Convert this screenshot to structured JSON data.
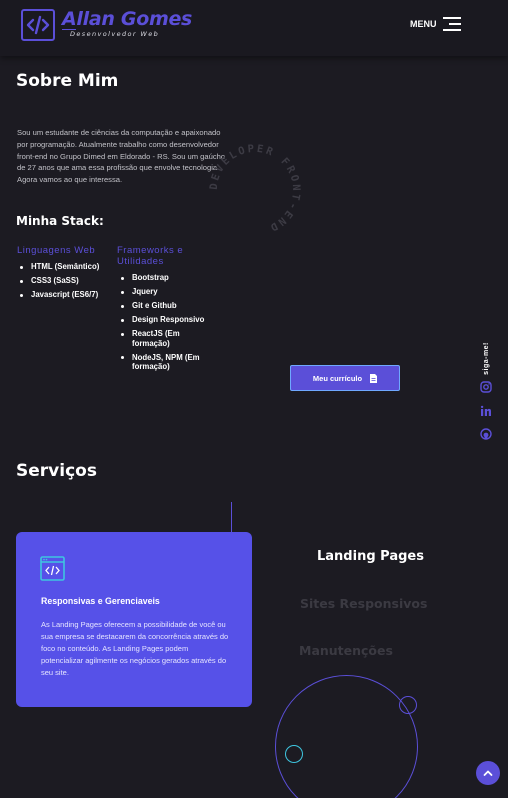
{
  "header": {
    "logo_name": "Allan Gomes",
    "logo_subtitle": "Desenvolvedor Web",
    "menu_label": "MENU",
    "brand_color": "#5b4fd8"
  },
  "about": {
    "title": "Sobre Mim",
    "text": "Sou um estudante de ciências da computação e apaixonado por programação. Atualmente trabalho como desenvolvedor front-end no Grupo Dimed em Eldorado - RS. Sou um gaúcho de 27 anos que ama essa profissão que envolve tecnologia. Agora vamos ao que interessa.",
    "circular_badge": "DEVELOPER FRONT-END ",
    "stack_title": "Minha Stack:",
    "columns": [
      {
        "title": "Linguagens Web",
        "items": [
          "HTML (Semântico)",
          "CSS3 (SaSS)",
          "Javascript (ES6/7)"
        ]
      },
      {
        "title": "Frameworks e Utilidades",
        "items": [
          "Bootstrap",
          "Jquery",
          "Git e Github",
          "Design Responsivo",
          "ReactJS (Em formação)",
          "NodeJS, NPM (Em formação)"
        ]
      }
    ],
    "cv_button": "Meu currículo"
  },
  "social": {
    "label": "siga-me!",
    "icons": [
      "instagram-icon",
      "linkedin-icon",
      "github-icon"
    ]
  },
  "services": {
    "title": "Serviços",
    "card": {
      "icon": "code-window-icon",
      "title": "Responsivas e Gerenciaveis",
      "text": "As Landing Pages oferecem a possibilidade de você ou sua empresa se destacarem da concorrência através do foco no conteúdo. As Landing Pages podem potencializar agilmente os negócios gerados através do seu site."
    },
    "tabs": [
      "Landing Pages",
      "Sites Responsivos",
      "Manutenções"
    ],
    "active_tab": "Landing Pages"
  }
}
